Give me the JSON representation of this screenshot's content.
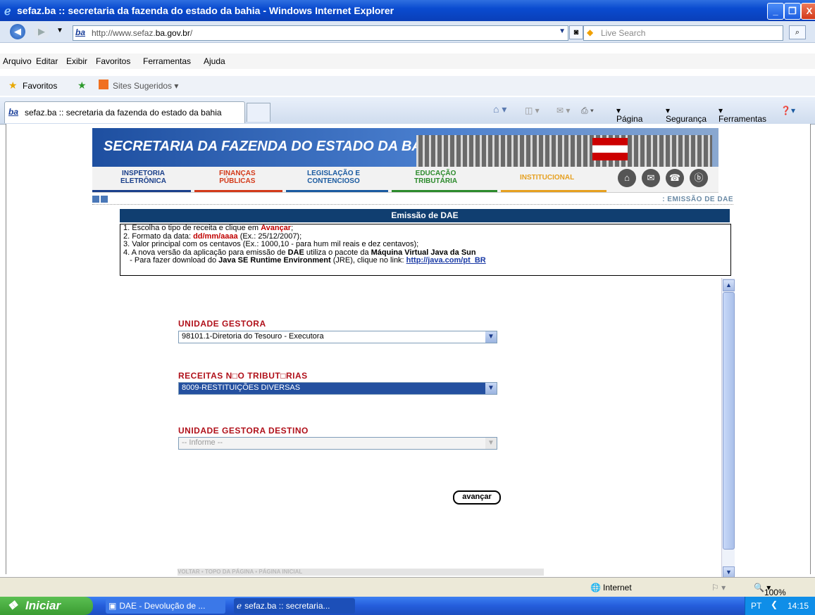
{
  "window": {
    "title": "sefaz.ba :: secretaria da fazenda do estado da bahia - Windows Internet Explorer",
    "minimize": "_",
    "restore": "❐",
    "close": "X"
  },
  "address_bar": {
    "url_prefix": "http://www.sefaz.",
    "url_domain": "ba.gov.br",
    "url_suffix": "/",
    "site_logo": "ba"
  },
  "search": {
    "placeholder": "Live Search"
  },
  "menu": [
    "Arquivo",
    "Editar",
    "Exibir",
    "Favoritos",
    "Ferramentas",
    "Ajuda"
  ],
  "favorites_bar": {
    "favoritos": "Favoritos",
    "sites_sugeridos": "Sites Sugeridos"
  },
  "tab": {
    "label": "sefaz.ba :: secretaria da fazenda do estado da bahia"
  },
  "command_bar": [
    "Página",
    "Segurança",
    "Ferramentas"
  ],
  "site": {
    "banner_title": "SECRETARIA DA FAZENDA DO ESTADO DA BAHIA",
    "nav": [
      {
        "line1": "INSPETORIA",
        "line2": "ELETRÔNICA",
        "color": "#1a3f8a",
        "bar": "#1a3f8a"
      },
      {
        "line1": "FINANÇAS",
        "line2": "PÚBLICAS",
        "color": "#d33a1a",
        "bar": "#d33a1a"
      },
      {
        "line1": "LEGISLAÇÃO E",
        "line2": "CONTENCIOSO",
        "color": "#1a5aa0",
        "bar": "#1a5aa0"
      },
      {
        "line1": "EDUCAÇÃO",
        "line2": "TRIBUTÁRIA",
        "color": "#2c8a2c",
        "bar": "#2c8a2c"
      },
      {
        "line1": "INSTITUCIONAL",
        "line2": "",
        "color": "#e6a020",
        "bar": "#e6a020"
      }
    ],
    "breadcrumb": ": EMISSÃO DE DAE",
    "form_title": "Emissão de DAE",
    "instructions": {
      "l1_a": "1. Escolha o tipo de receita e clique em ",
      "l1_b": "Avançar",
      "l1_c": ";",
      "l2_a": "2. Formato da data: ",
      "l2_b": "dd/mm/aaaa",
      "l2_c": " (Ex.: 25/12/2007);",
      "l3": "3. Valor principal com os centavos (Ex.: 1000,10 - para hum mil reais e dez centavos);",
      "l4_a": "4. A nova versão da aplicação para emissão de ",
      "l4_b": "DAE",
      "l4_c": " utiliza o pacote da ",
      "l4_d": "Máquina Virtual Java da Sun",
      "l5_a": "   - Para fazer download do ",
      "l5_b": "Java SE Runtime Environment",
      "l5_c": " (JRE), clique no link: ",
      "l5_link": "http://java.com/pt_BR"
    },
    "fields": {
      "unidade_gestora_label": "UNIDADE GESTORA",
      "unidade_gestora_value": "98101.1-Diretoria do Tesouro - Executora",
      "receitas_label": "RECEITAS N□O TRIBUT□RIAS",
      "receitas_value": "8009-RESTITUIÇÕES DIVERSAS",
      "destino_label": "UNIDADE GESTORA DESTINO",
      "destino_value": "-- Informe --"
    },
    "avancar": "avançar",
    "footer_links": [
      "VOLTAR",
      "TOPO DA PÁGINA",
      "PÁGINA INICIAL"
    ]
  },
  "status_bar": {
    "zone": "Internet",
    "zoom": "100%"
  },
  "taskbar": {
    "start": "Iniciar",
    "buttons": [
      "DAE - Devolução de ...",
      "sefaz.ba :: secretaria..."
    ],
    "lang": "PT",
    "clock": "14:15"
  }
}
